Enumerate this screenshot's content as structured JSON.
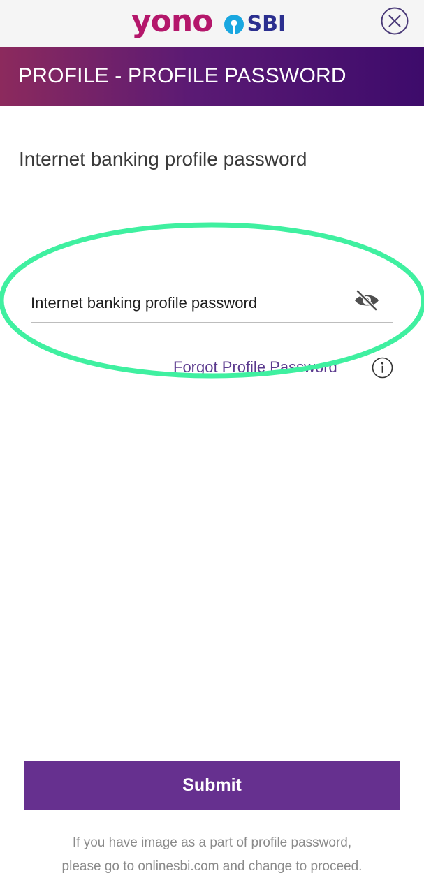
{
  "app": {
    "brand_yono": "yono",
    "brand_sbi": "SBI"
  },
  "icons": {
    "close": "close-circle-icon",
    "eye": "eye-off-icon",
    "info": "info-circle-icon",
    "sbi_logo": "sbi-logo-icon"
  },
  "header": {
    "title": "PROFILE - PROFILE PASSWORD"
  },
  "content": {
    "section_title": "Internet banking profile password",
    "password_field": {
      "placeholder": "Internet banking profile password",
      "value": ""
    },
    "forgot_link": "Forgot Profile Password"
  },
  "actions": {
    "submit_label": "Submit"
  },
  "footer": {
    "line1": "If you have image as a part of profile password,",
    "line2": "please go to onlinesbi.com and change to proceed."
  },
  "colors": {
    "brand_magenta": "#b4176b",
    "brand_blue": "#2b2f8f",
    "sbi_cyan": "#1aa7e0",
    "header_start": "#8c2a5d",
    "header_end": "#3d0b6b",
    "submit_bg": "#66308f",
    "annotation": "#3ff0a0"
  }
}
